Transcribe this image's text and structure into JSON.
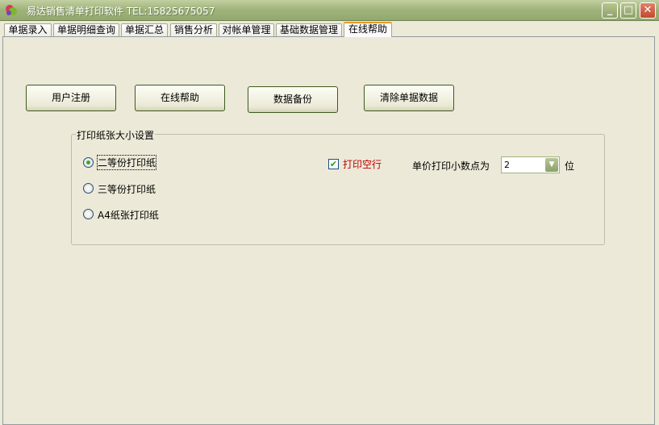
{
  "window": {
    "title": "易达销售清单打印软件 TEL:15825675057",
    "minimize": "_",
    "maximize": "□",
    "close": "✕"
  },
  "tabs": [
    "单据录入",
    "单据明细查询",
    "单据汇总",
    "销售分析",
    "对帐单管理",
    "基础数据管理",
    "在线帮助"
  ],
  "active_tab": "在线帮助",
  "buttons": {
    "register": "用户注册",
    "help": "在线帮助",
    "backup": "数据备份",
    "clear": "清除单据数据"
  },
  "print_settings": {
    "legend": "打印纸张大小设置",
    "options": [
      "二等份打印纸",
      "三等份打印纸",
      "A4纸张打印纸"
    ],
    "selected": "二等份打印纸",
    "print_blank_rows": {
      "label": "打印空行",
      "checked": true,
      "check_glyph": "✔"
    },
    "decimal_label": "单价打印小数点为",
    "decimal_value": "2",
    "decimal_arrow": "▼",
    "decimal_suffix": "位"
  }
}
